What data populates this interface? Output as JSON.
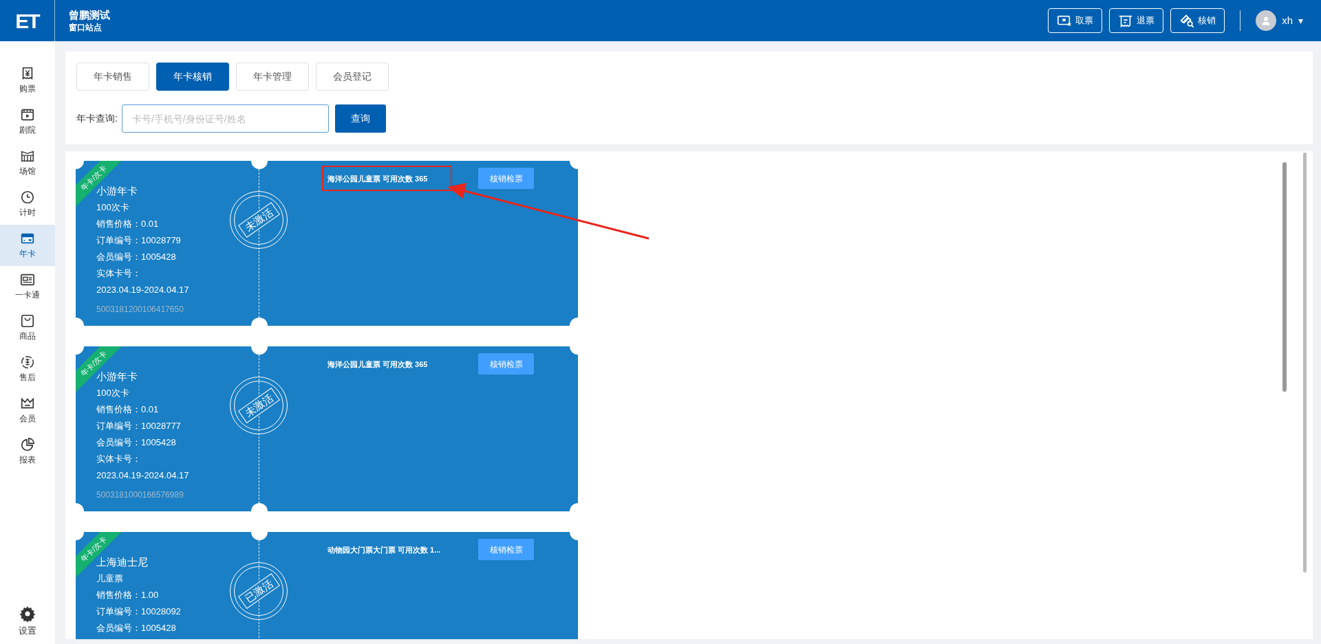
{
  "header": {
    "logo": "ET",
    "title": "曾鹏测试",
    "subtitle": "窗口站点",
    "actions": [
      {
        "label": "取票"
      },
      {
        "label": "退票"
      },
      {
        "label": "核销"
      }
    ],
    "user": {
      "name": "xh",
      "caret": "▾"
    }
  },
  "sidebar": {
    "items": [
      {
        "label": "购票",
        "selected": false
      },
      {
        "label": "剧院",
        "selected": false
      },
      {
        "label": "场馆",
        "selected": false
      },
      {
        "label": "计时",
        "selected": false
      },
      {
        "label": "年卡",
        "selected": true
      },
      {
        "label": "一卡通",
        "selected": false
      },
      {
        "label": "商品",
        "selected": false
      },
      {
        "label": "售后",
        "selected": false
      },
      {
        "label": "会员",
        "selected": false
      },
      {
        "label": "报表",
        "selected": false
      }
    ],
    "footer": {
      "label": "设置"
    }
  },
  "tabs": [
    {
      "label": "年卡销售",
      "selected": false
    },
    {
      "label": "年卡核销",
      "selected": true
    },
    {
      "label": "年卡管理",
      "selected": false
    },
    {
      "label": "会员登记",
      "selected": false
    }
  ],
  "search": {
    "label": "年卡查询:",
    "placeholder": "卡号/手机号/身份证号/姓名",
    "button": "查询"
  },
  "cards": [
    {
      "tag": "年卡/次卡",
      "name": "小游年卡",
      "type": "100次卡",
      "fields": [
        "销售价格：0.01",
        "订单编号：10028779",
        "会员编号：1005428",
        "实体卡号：",
        "2023.04.19-2024.04.17"
      ],
      "serial": "5003181200106417650",
      "stamp": "未激活",
      "product": "海洋公园儿童票 可用次数 365",
      "highlighted": true,
      "button": "核销检票"
    },
    {
      "tag": "年卡/次卡",
      "name": "小游年卡",
      "type": "100次卡",
      "fields": [
        "销售价格：0.01",
        "订单编号：10028777",
        "会员编号：1005428",
        "实体卡号：",
        "2023.04.19-2024.04.17"
      ],
      "serial": "5003181000166576989",
      "stamp": "未激活",
      "product": "海洋公园儿童票 可用次数 365",
      "highlighted": false,
      "button": "核销检票"
    },
    {
      "tag": "年卡/次卡",
      "name": "上海迪士尼",
      "type": "儿童票",
      "fields": [
        "销售价格：1.00",
        "订单编号：10028092",
        "会员编号：1005428"
      ],
      "stamp": "已激活",
      "product": "动物园大门票大门票 可用次数 1...",
      "highlighted": false,
      "button": "核销检票"
    }
  ]
}
